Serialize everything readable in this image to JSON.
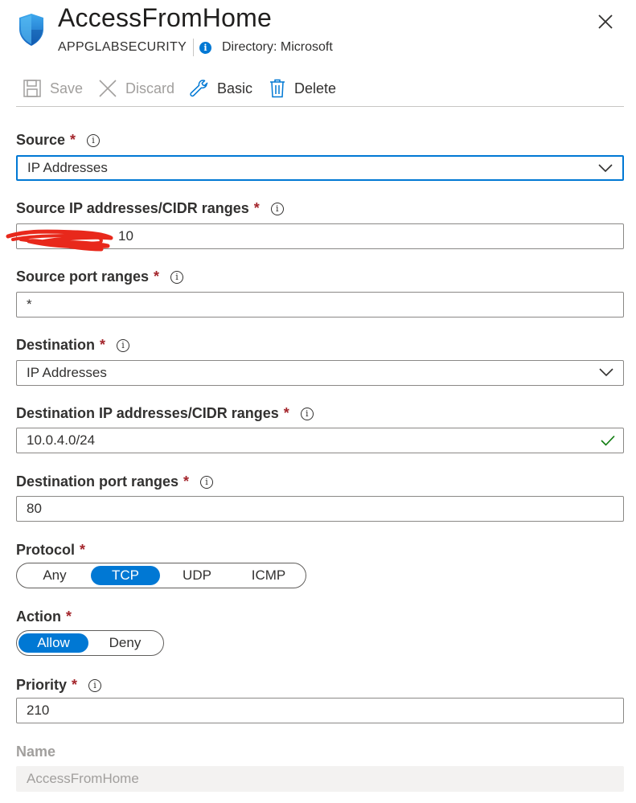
{
  "header": {
    "title": "AccessFromHome",
    "subtitle": "APPGLABSECURITY",
    "directory": "Directory: Microsoft"
  },
  "toolbar": {
    "save_label": "Save",
    "discard_label": "Discard",
    "basic_label": "Basic",
    "delete_label": "Delete"
  },
  "form": {
    "source": {
      "label": "Source",
      "required": "*",
      "value": "IP Addresses"
    },
    "source_ip": {
      "label": "Source IP addresses/CIDR ranges",
      "required": "*",
      "value": "10"
    },
    "source_port": {
      "label": "Source port ranges",
      "required": "*",
      "value": "*"
    },
    "destination": {
      "label": "Destination",
      "required": "*",
      "value": "IP Addresses"
    },
    "destination_ip": {
      "label": "Destination IP addresses/CIDR ranges",
      "required": "*",
      "value": "10.0.4.0/24"
    },
    "destination_port": {
      "label": "Destination port ranges",
      "required": "*",
      "value": "80"
    },
    "protocol": {
      "label": "Protocol",
      "required": "*",
      "options": [
        "Any",
        "TCP",
        "UDP",
        "ICMP"
      ],
      "selected": "TCP"
    },
    "action": {
      "label": "Action",
      "required": "*",
      "options": [
        "Allow",
        "Deny"
      ],
      "selected": "Allow"
    },
    "priority": {
      "label": "Priority",
      "required": "*",
      "value": "210"
    },
    "name": {
      "label": "Name",
      "value": "AccessFromHome"
    }
  },
  "info_glyph": "i",
  "colors": {
    "accent": "#0078d4",
    "required": "#a4262c",
    "success": "#107c10",
    "redaction": "#e8281b"
  },
  "icons": [
    "shield-icon",
    "close-icon",
    "save-icon",
    "discard-icon",
    "wrench-icon",
    "trash-icon",
    "info-icon",
    "chevron-down-icon",
    "checkmark-icon"
  ]
}
